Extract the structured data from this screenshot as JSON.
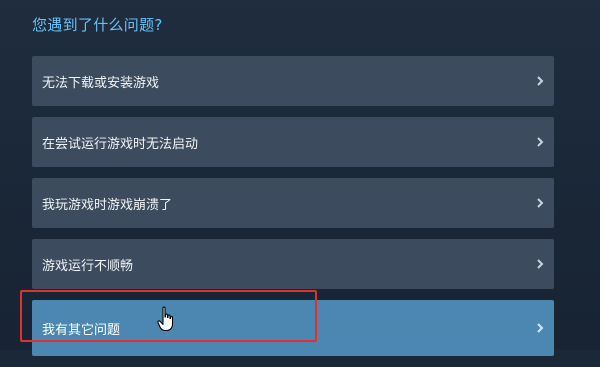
{
  "title": "您遇到了什么问题?",
  "menu": {
    "items": [
      {
        "label": "无法下载或安装游戏"
      },
      {
        "label": "在尝试运行游戏时无法启动"
      },
      {
        "label": "我玩游戏时游戏崩溃了"
      },
      {
        "label": "游戏运行不顺畅"
      },
      {
        "label": "我有其它问题"
      }
    ]
  },
  "icons": {
    "chevron": "chevron-right-icon",
    "cursor": "hand-pointer-icon"
  },
  "colors": {
    "accent": "#67c1f5",
    "item_bg": "#3d4b5e",
    "item_highlight_bg": "#4b87b0",
    "annotation": "#e03030"
  }
}
